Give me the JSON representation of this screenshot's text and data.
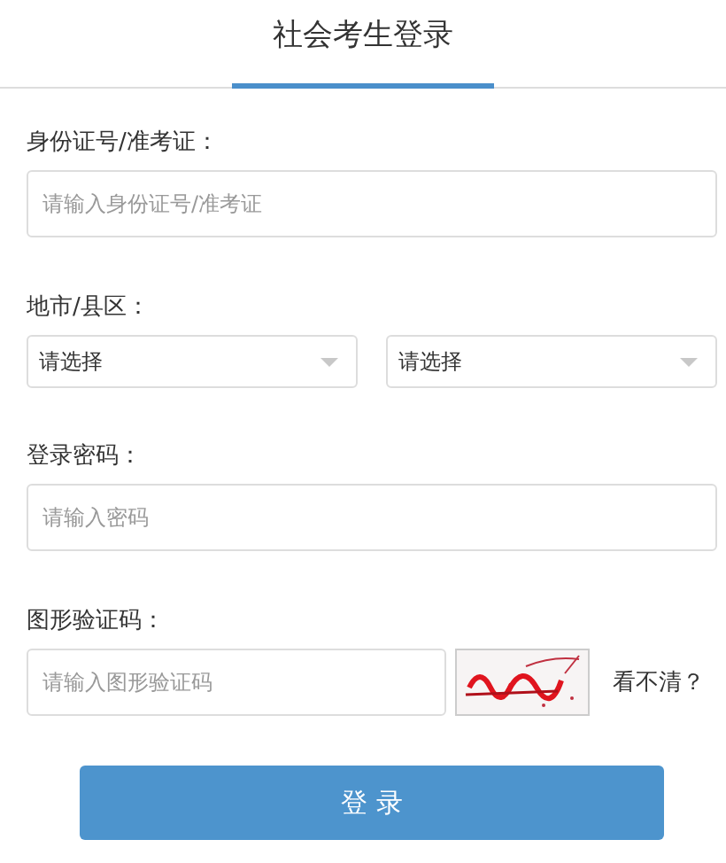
{
  "tabs": [
    {
      "label": "社会考生登录",
      "selected": true
    }
  ],
  "fields": [
    {
      "kind": "input",
      "label": "身份证号/准考证：",
      "placeholder": "请输入身份证号/准考证"
    },
    {
      "kind": "selects",
      "label": "地市/县区：",
      "selects": [
        {
          "value": "请选择"
        },
        {
          "value": "请选择"
        }
      ]
    },
    {
      "kind": "input",
      "label": "登录密码：",
      "placeholder": "请输入密码"
    },
    {
      "kind": "captcha",
      "label": "图形验证码：",
      "placeholder": "请输入图形验证码",
      "refresh": "看不清？"
    }
  ],
  "submit": "登 录"
}
